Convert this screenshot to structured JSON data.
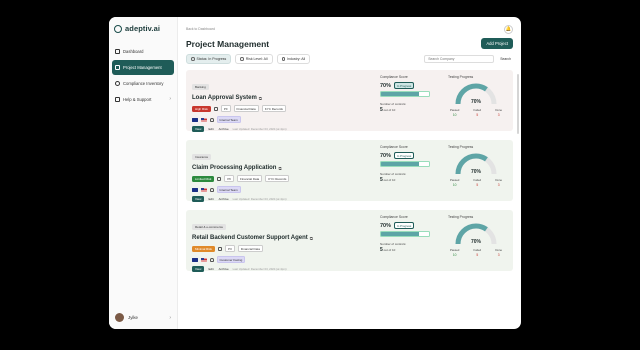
{
  "app": {
    "name": "adeptiv.ai"
  },
  "sidebar": {
    "items": [
      {
        "label": "Dashboard",
        "icon": "grid-icon"
      },
      {
        "label": "Project Management",
        "icon": "folder-icon",
        "active": true
      },
      {
        "label": "Compliance Inventory",
        "icon": "shield-icon"
      },
      {
        "label": "Help & Support",
        "icon": "chat-icon",
        "chevron": "›"
      }
    ],
    "user": {
      "name": "Jyike",
      "chevron": "›"
    }
  },
  "header": {
    "breadcrumb": "Back to Dashboard",
    "title": "Project Management",
    "add_button": "Add Project"
  },
  "filters": {
    "chips": [
      "Status: In Progress",
      "Risk Level: All",
      "Industry: All"
    ],
    "search_placeholder": "Search Company",
    "search_button": "Search"
  },
  "labels": {
    "compliance_score": "Compliance Score",
    "testing_progress": "Testing Progress",
    "number_of_controls": "Number of controls:",
    "passed": "Passed",
    "failed": "Failed",
    "done": "Done",
    "view": "View",
    "edit": "Edit",
    "archive": "Archive"
  },
  "colors": {
    "accent": "#1f5c58",
    "bar": "#5ea5a6",
    "high_risk": "#c8372e",
    "limited_risk": "#e08a2a"
  },
  "projects": [
    {
      "industry": "Banking",
      "name": "Loan Approval System",
      "risk": "High Risk",
      "risk_color": "#c8372e",
      "data": [
        "PII",
        "Financial Data",
        "KYC Records"
      ],
      "team": "Internal Team",
      "updated": "Last Updated: December 03, 2024 (at 4pm)",
      "score": "70%",
      "status": "In Progress",
      "status_dark": true,
      "bar_fraction": 0.8,
      "controls_done": "5",
      "controls_total": "out of 10",
      "gauge": "70%",
      "gauge_fraction": 0.7,
      "passed": "10",
      "failed": "5",
      "done": "3"
    },
    {
      "industry": "Insurance",
      "name": "Claim Processing Application",
      "risk": "Limited Risk",
      "risk_color": "#2c8a3e",
      "data": [
        "PII",
        "Financial Data",
        "KYC Records"
      ],
      "team": "Internal Team",
      "updated": "Last Updated: December 03, 2024 (at 4pm)",
      "score": "70%",
      "status": "In Progress",
      "status_dark": false,
      "bar_fraction": 0.8,
      "controls_done": "5",
      "controls_total": "out of 10",
      "gauge": "70%",
      "gauge_fraction": 0.7,
      "passed": "10",
      "failed": "5",
      "done": "3"
    },
    {
      "industry": "Retail & e-commerce",
      "name": "Retail Backend Customer Support Agent",
      "risk": "Minimal Risk",
      "risk_color": "#e08a2a",
      "data": [
        "PII",
        "Financial Data"
      ],
      "team": "Customer Facing",
      "updated": "Last Updated: December 03, 2024 (at 4pm)",
      "score": "70%",
      "status": "In Progress",
      "status_dark": false,
      "bar_fraction": 0.8,
      "controls_done": "5",
      "controls_total": "out of 10",
      "gauge": "70%",
      "gauge_fraction": 0.7,
      "passed": "10",
      "failed": "5",
      "done": "3"
    }
  ]
}
